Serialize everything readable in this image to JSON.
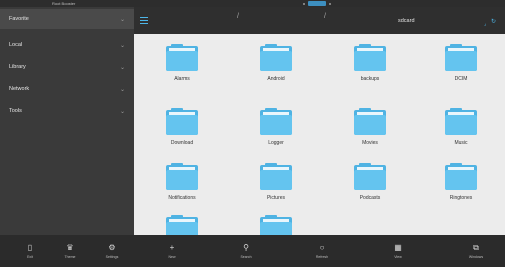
{
  "app_title": "Root Booster",
  "sidebar": {
    "items": [
      {
        "label": "Favorite"
      },
      {
        "label": "Local"
      },
      {
        "label": "Library"
      },
      {
        "label": "Network"
      },
      {
        "label": "Tools"
      }
    ]
  },
  "header": {
    "separator": "/",
    "path_title": "sdcard"
  },
  "folders": [
    {
      "name": "Alarms"
    },
    {
      "name": "Android"
    },
    {
      "name": "backups"
    },
    {
      "name": "DCIM"
    },
    {
      "name": "Download"
    },
    {
      "name": "Logger"
    },
    {
      "name": "Movies"
    },
    {
      "name": "Music"
    },
    {
      "name": "Notifications"
    },
    {
      "name": "Pictures"
    },
    {
      "name": "Podcasts"
    },
    {
      "name": "Ringtones"
    },
    {
      "name": ""
    },
    {
      "name": ""
    }
  ],
  "toolbar_left": [
    {
      "icon": "exit-icon",
      "label": "Exit"
    },
    {
      "icon": "theme-icon",
      "label": "Theme"
    },
    {
      "icon": "settings-icon",
      "label": "Settings"
    }
  ],
  "toolbar_right": [
    {
      "icon": "new-icon",
      "label": "New"
    },
    {
      "icon": "search-icon",
      "label": "Search"
    },
    {
      "icon": "refresh-icon",
      "label": "Refresh"
    },
    {
      "icon": "view-icon",
      "label": "View"
    },
    {
      "icon": "windows-icon",
      "label": "Windows"
    }
  ],
  "colors": {
    "accent": "#4db6e8",
    "folder": "#64c4ef",
    "sidebar_bg": "#3a3a3a",
    "grid_bg": "#ececec"
  }
}
